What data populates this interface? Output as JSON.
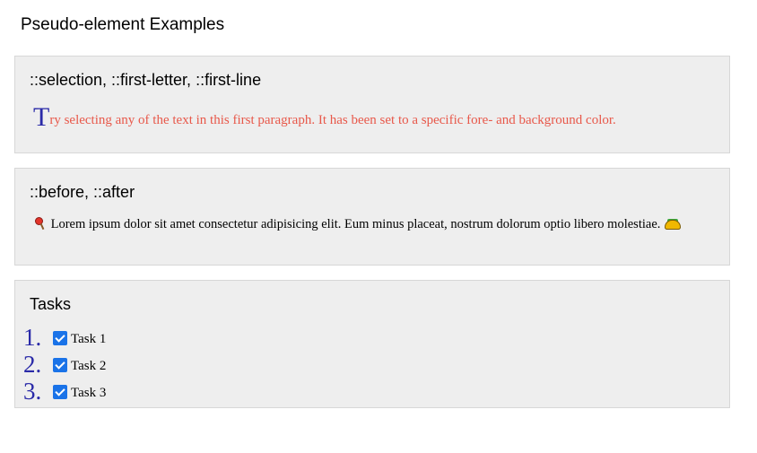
{
  "page": {
    "title": "Pseudo-element Examples"
  },
  "sections": [
    {
      "heading": "::selection, ::first-letter, ::first-line",
      "paragraph_first_letter": "T",
      "paragraph_rest": "ry selecting any of the text in this first paragraph. It has been set to a specific fore- and background color."
    },
    {
      "heading": "::before, ::after",
      "before_icon": "lollipop-icon",
      "paragraph": "Lorem ipsum dolor sit amet consectetur adipisicing elit. Eum minus placeat, nostrum dolorum optio libero molestiae.",
      "after_icon": "taco-icon"
    },
    {
      "heading": "Tasks",
      "tasks": [
        {
          "number": "1.",
          "label": "Task 1",
          "checked": true
        },
        {
          "number": "2.",
          "label": "Task 2",
          "checked": true
        },
        {
          "number": "3.",
          "label": "Task 3",
          "checked": true
        }
      ]
    }
  ],
  "colors": {
    "card_background": "#eeeeee",
    "first_line_text": "#e8584a",
    "first_letter_and_markers": "#2a2aa8",
    "checkbox_accent": "#1a73e8"
  }
}
